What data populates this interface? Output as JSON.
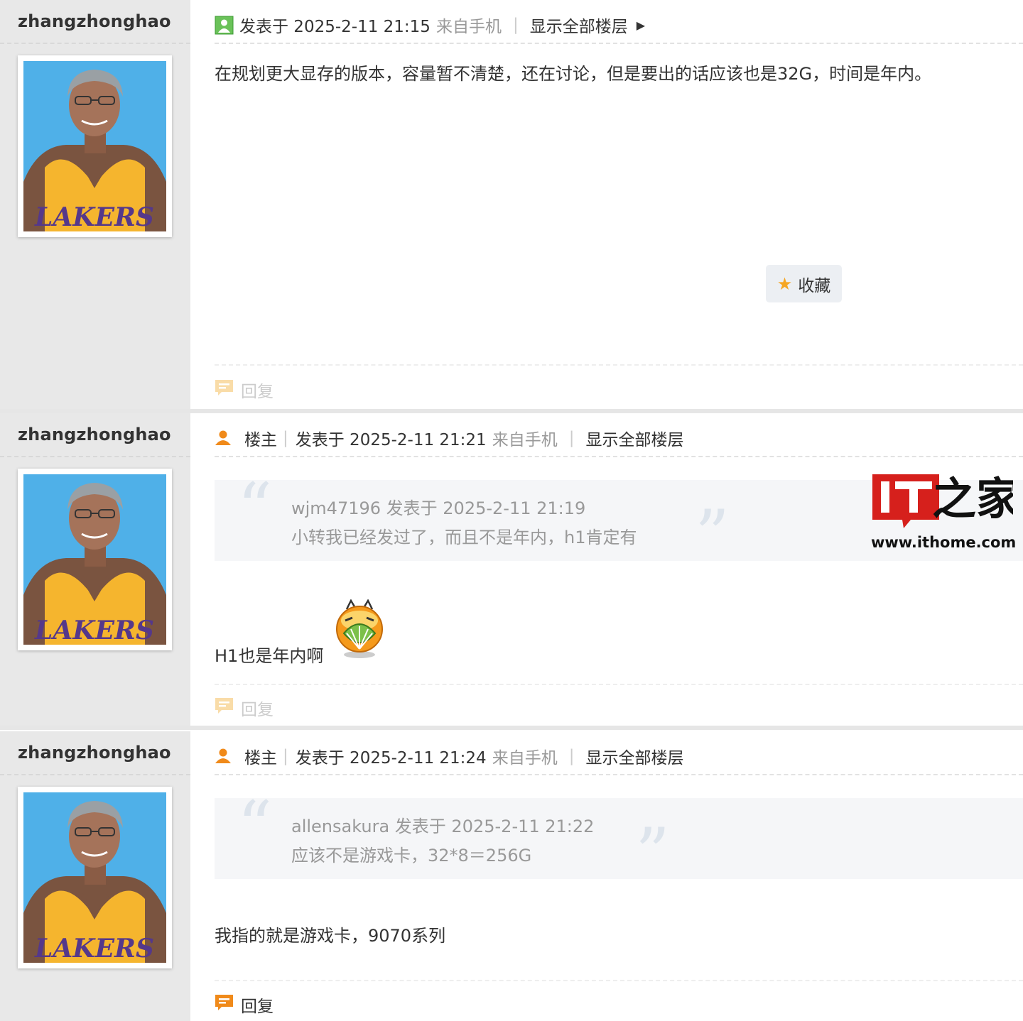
{
  "posts": [
    {
      "username": "zhangzhonghao",
      "is_op": false,
      "op_label": "",
      "posted_at": "发表于 2025-2-11 21:15",
      "source": "来自手机",
      "show_all": "显示全部楼层",
      "quote": null,
      "content": "在规划更大显存的版本，容量暂不清楚，还在讨论，但是要出的话应该也是32G，时间是年内。",
      "favorite_label": "收藏",
      "reply_label": "回复"
    },
    {
      "username": "zhangzhonghao",
      "is_op": true,
      "op_label": "楼主",
      "posted_at": "发表于 2025-2-11 21:21",
      "source": "来自手机",
      "show_all": "显示全部楼层",
      "quote": {
        "header": "wjm47196 发表于 2025-2-11 21:19",
        "text": "小转我已经发过了，而且不是年内，h1肯定有"
      },
      "content": "H1也是年内啊",
      "reply_label": "回复"
    },
    {
      "username": "zhangzhonghao",
      "is_op": true,
      "op_label": "楼主",
      "posted_at": "发表于 2025-2-11 21:24",
      "source": "来自手机",
      "show_all": "显示全部楼层",
      "quote": {
        "header": "allensakura 发表于 2025-2-11 21:22",
        "text": "应该不是游戏卡，32*8＝256G"
      },
      "content": "我指的就是游戏卡，9070系列",
      "reply_label": "回复"
    }
  ],
  "avatar_jersey_text": "LAKERS",
  "watermark": {
    "logo": "IT之家",
    "url": "www.ithome.com"
  },
  "icons": {
    "status": "online-status-icon",
    "op": "person-icon",
    "expand": "triangle-right-icon",
    "favorite": "star-icon",
    "reply": "comment-icon",
    "emoji": "emoji-icon"
  },
  "colors": {
    "accent_orange": "#f08a1a",
    "star": "#f5a623",
    "online_green": "#4caf50",
    "meta_gray": "#999999"
  }
}
